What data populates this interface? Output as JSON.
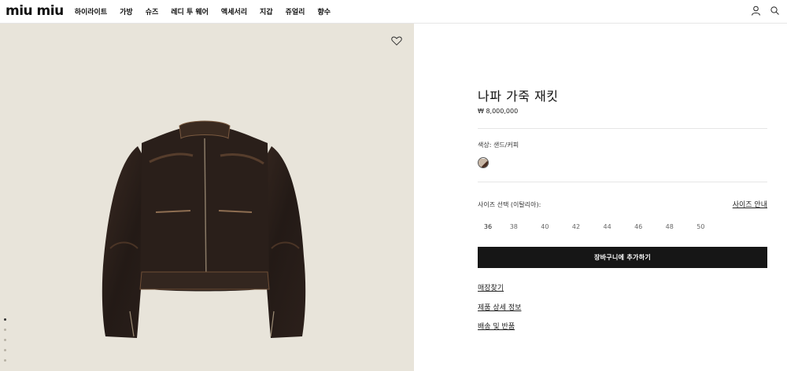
{
  "header": {
    "logo": "miu miu",
    "nav": [
      "하이라이트",
      "가방",
      "슈즈",
      "레디 투 웨어",
      "액세서리",
      "지갑",
      "쥬얼리",
      "향수"
    ],
    "icons": [
      "user-icon",
      "search-icon"
    ]
  },
  "gallery": {
    "icon": "heart-icon",
    "slide_count": 5,
    "active_slide": 1,
    "background": "#e8e4da"
  },
  "product": {
    "title": "나파 가죽 재킷",
    "price": "₩ 8,000,000",
    "color_label": "색상: 샌드/커피",
    "swatch_colors": [
      "#c8b7a6",
      "#4a2e22"
    ],
    "size_label": "사이즈 선택 (이탈리아):",
    "size_guide": "사이즈 안내",
    "sizes": [
      "36",
      "38",
      "40",
      "42",
      "44",
      "46",
      "48",
      "50"
    ],
    "add_to_cart": "장바구니에 추가하기",
    "links": {
      "store": "매장찾기",
      "details": "제품 상세 정보",
      "shipping": "배송 및 반품"
    }
  }
}
